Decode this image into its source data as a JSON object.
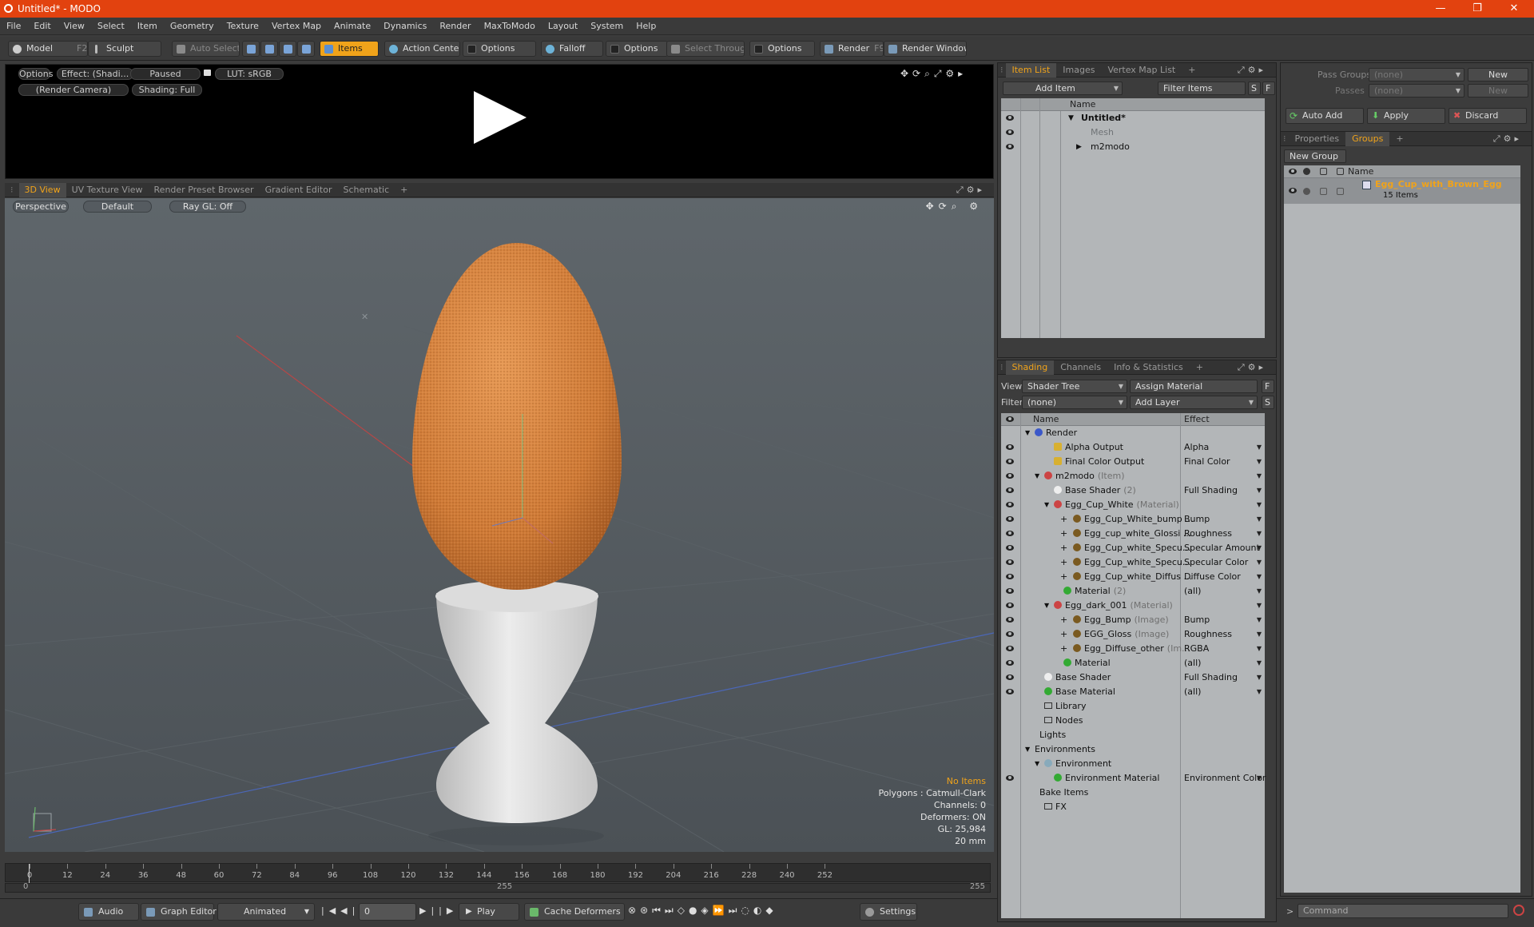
{
  "window": {
    "title": "Untitled* - MODO",
    "min": "—",
    "max": "❐",
    "close": "✕"
  },
  "menu": [
    "File",
    "Edit",
    "View",
    "Select",
    "Item",
    "Geometry",
    "Texture",
    "Vertex Map",
    "Animate",
    "Dynamics",
    "Render",
    "MaxToModo",
    "Layout",
    "System",
    "Help"
  ],
  "toolbar": {
    "model": "Model",
    "model_key": "F2",
    "sculpt": "Sculpt",
    "auto_select": "Auto Select",
    "items": "Items",
    "action_center": "Action Center",
    "options1": "Options",
    "falloff": "Falloff",
    "options2": "Options",
    "select_through": "Select Through",
    "options3": "Options",
    "render": "Render",
    "render_key": "F9",
    "render_window": "Render Window"
  },
  "preview": {
    "options": "Options",
    "effect": "Effect: (Shadi...",
    "paused": "Paused",
    "lut": "LUT: sRGB",
    "camera": "(Render Camera)",
    "shading": "Shading: Full"
  },
  "viewtabs": [
    "3D View",
    "UV Texture View",
    "Render Preset Browser",
    "Gradient Editor",
    "Schematic",
    "+"
  ],
  "viewport": {
    "perspective": "Perspective",
    "default": "Default",
    "raygl": "Ray GL: Off",
    "info": {
      "no_items": "No Items",
      "polygons": "Polygons : Catmull-Clark",
      "channels": "Channels: 0",
      "deformers": "Deformers: ON",
      "gl": "GL: 25,984",
      "scale": "20 mm"
    }
  },
  "timeline": {
    "ticks": [
      "0",
      "12",
      "24",
      "36",
      "48",
      "60",
      "72",
      "84",
      "96",
      "108",
      "120",
      "132",
      "144",
      "156",
      "168",
      "180",
      "192",
      "204",
      "216",
      "228",
      "240",
      "252"
    ],
    "start": "0",
    "mid": "255",
    "end": "255"
  },
  "bottombar": {
    "audio": "Audio",
    "graph_editor": "Graph Editor",
    "animated": "Animated",
    "frame": "0",
    "play": "Play",
    "cache_deformers": "Cache Deformers",
    "settings": "Settings"
  },
  "itemlist": {
    "tabs": [
      "Item List",
      "Images",
      "Vertex Map List",
      "+"
    ],
    "add_item": "Add Item",
    "filter_items": "Filter Items",
    "s_btn": "S",
    "f_btn": "F",
    "col_name": "Name",
    "rows": [
      {
        "label": "Untitled*"
      },
      {
        "label": "Mesh"
      },
      {
        "label": "m2modo"
      }
    ]
  },
  "shading": {
    "tabs": [
      "Shading",
      "Channels",
      "Info & Statistics",
      "+"
    ],
    "view_label": "View",
    "view_value": "Shader Tree",
    "assign_material": "Assign Material",
    "f_btn": "F",
    "filter_label": "Filter",
    "filter_value": "(none)",
    "add_layer": "Add Layer",
    "s_btn": "S",
    "col_name": "Name",
    "col_effect": "Effect",
    "rows": [
      {
        "name": "Render",
        "tag": "",
        "effect": ""
      },
      {
        "name": "Alpha Output",
        "tag": "",
        "effect": "Alpha"
      },
      {
        "name": "Final Color Output",
        "tag": "",
        "effect": "Final Color"
      },
      {
        "name": "m2modo",
        "tag": "(Item)",
        "effect": ""
      },
      {
        "name": "Base Shader",
        "tag": "(2)",
        "effect": "Full Shading"
      },
      {
        "name": "Egg_Cup_White",
        "tag": "(Material)",
        "effect": ""
      },
      {
        "name": "Egg_Cup_White_bump ...",
        "tag": "",
        "effect": "Bump"
      },
      {
        "name": "Egg_cup_white_Glossi ...",
        "tag": "",
        "effect": "Roughness"
      },
      {
        "name": "Egg_Cup_white_Specu...",
        "tag": "",
        "effect": "Specular Amount"
      },
      {
        "name": "Egg_Cup_white_Specu...",
        "tag": "",
        "effect": "Specular Color"
      },
      {
        "name": "Egg_Cup_white_Diffus ...",
        "tag": "",
        "effect": "Diffuse Color"
      },
      {
        "name": "Material",
        "tag": "(2)",
        "effect": "(all)"
      },
      {
        "name": "Egg_dark_001",
        "tag": "(Material)",
        "effect": ""
      },
      {
        "name": "Egg_Bump",
        "tag": "(Image)",
        "effect": "Bump"
      },
      {
        "name": "EGG_Gloss",
        "tag": "(Image)",
        "effect": "Roughness"
      },
      {
        "name": "Egg_Diffuse_other",
        "tag": "(Im...",
        "effect": "RGBA"
      },
      {
        "name": "Material",
        "tag": "",
        "effect": "(all)"
      },
      {
        "name": "Base Shader",
        "tag": "",
        "effect": "Full Shading"
      },
      {
        "name": "Base Material",
        "tag": "",
        "effect": "(all)"
      },
      {
        "name": "Library",
        "tag": "",
        "effect": ""
      },
      {
        "name": "Nodes",
        "tag": "",
        "effect": ""
      },
      {
        "name": "Lights",
        "tag": "",
        "effect": ""
      },
      {
        "name": "Environments",
        "tag": "",
        "effect": ""
      },
      {
        "name": "Environment",
        "tag": "",
        "effect": ""
      },
      {
        "name": "Environment Material",
        "tag": "",
        "effect": "Environment Color"
      },
      {
        "name": "Bake Items",
        "tag": "",
        "effect": ""
      },
      {
        "name": "FX",
        "tag": "",
        "effect": ""
      }
    ]
  },
  "passes": {
    "pass_groups": "Pass Groups",
    "passes": "Passes",
    "none": "(none)",
    "new": "New",
    "auto_add": "Auto Add",
    "apply": "Apply",
    "discard": "Discard"
  },
  "groups": {
    "tabs": [
      "Properties",
      "Groups",
      "+"
    ],
    "new_group": "New Group",
    "col_name": "Name",
    "group_name": "Egg_Cup_with_Brown_Egg",
    "group_count": "15 Items"
  },
  "command": {
    "placeholder": "Command"
  },
  "colors": {
    "accent": "#f0a31a",
    "title_bar": "#e2420f"
  }
}
